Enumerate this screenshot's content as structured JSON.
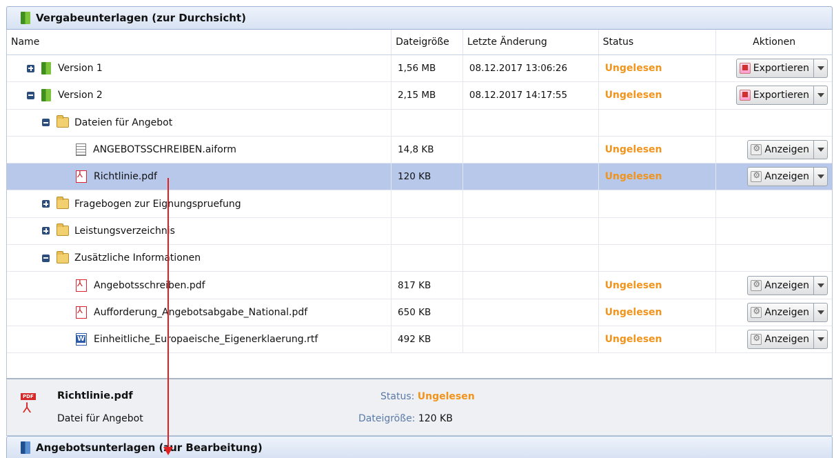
{
  "top_panel": {
    "title": "Vergabeunterlagen (zur Durchsicht)"
  },
  "columns": {
    "name": "Name",
    "size": "Dateigröße",
    "date": "Letzte Änderung",
    "status": "Status",
    "actions": "Aktionen"
  },
  "rows": [
    {
      "name": "Version 1",
      "size": "1,56 MB",
      "date": "08.12.2017 13:06:26",
      "status": "Ungelesen",
      "action": "Exportieren"
    },
    {
      "name": "Version 2",
      "size": "2,15 MB",
      "date": "08.12.2017 14:17:55",
      "status": "Ungelesen",
      "action": "Exportieren"
    },
    {
      "name": "Dateien für Angebot"
    },
    {
      "name": "ANGEBOTSSCHREIBEN.aiform",
      "size": "14,8 KB",
      "status": "Ungelesen",
      "action": "Anzeigen"
    },
    {
      "name": "Richtlinie.pdf",
      "size": "120 KB",
      "status": "Ungelesen",
      "action": "Anzeigen"
    },
    {
      "name": "Fragebogen zur Eignungspruefung"
    },
    {
      "name": "Leistungsverzeichnis"
    },
    {
      "name": "Zusätzliche Informationen"
    },
    {
      "name": "Angebotsschreiben.pdf",
      "size": "817 KB",
      "status": "Ungelesen",
      "action": "Anzeigen"
    },
    {
      "name": "Aufforderung_Angebotsabgabe_National.pdf",
      "size": "650 KB",
      "status": "Ungelesen",
      "action": "Anzeigen"
    },
    {
      "name": "Einheitliche_Europaeische_Eigenerklaerung.rtf",
      "size": "492 KB",
      "status": "Ungelesen",
      "action": "Anzeigen"
    }
  ],
  "details": {
    "pdf_tag": "PDF",
    "title": "Richtlinie.pdf",
    "subtitle": "Datei für Angebot",
    "status_label": "Status:",
    "status_value": "Ungelesen",
    "size_label": "Dateigröße:",
    "size_value": "120 KB"
  },
  "bottom_panel": {
    "title": "Angebotsunterlagen (zur Bearbeitung)"
  },
  "colors": {
    "status": "#f0941c",
    "selected_row": "#b7c8eb",
    "annotation": "#e02020"
  }
}
